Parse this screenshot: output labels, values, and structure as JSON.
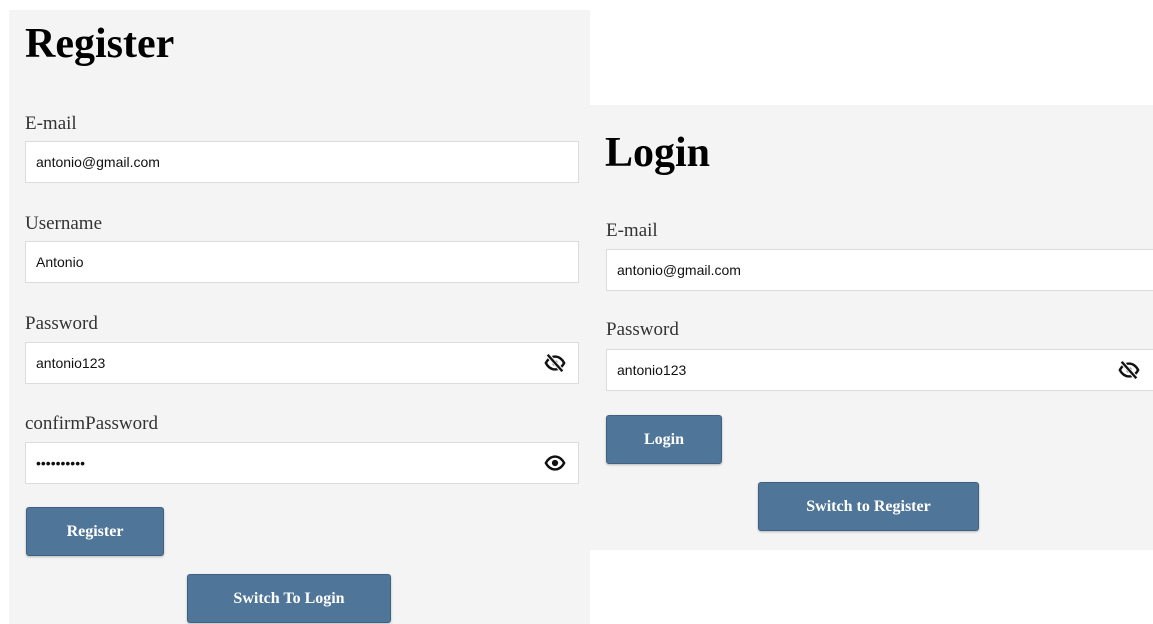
{
  "register": {
    "title": "Register",
    "email": {
      "label": "E-mail",
      "value": "antonio@gmail.com"
    },
    "username": {
      "label": "Username",
      "value": "Antonio"
    },
    "password": {
      "label": "Password",
      "value": "antonio123",
      "icon": "eye-slash-icon"
    },
    "confirm_password": {
      "label": "confirmPassword",
      "value": "••••••••••",
      "icon": "eye-icon"
    },
    "submit_label": "Register",
    "switch_label": "Switch To Login"
  },
  "login": {
    "title": "Login",
    "email": {
      "label": "E-mail",
      "value": "antonio@gmail.com"
    },
    "password": {
      "label": "Password",
      "value": "antonio123",
      "icon": "eye-slash-icon"
    },
    "submit_label": "Login",
    "switch_label": "Switch to Register"
  },
  "colors": {
    "panel_background": "#f4f4f5",
    "button_background": "#4f7699",
    "button_text": "#ffffff",
    "input_border": "#dcdcdc"
  }
}
